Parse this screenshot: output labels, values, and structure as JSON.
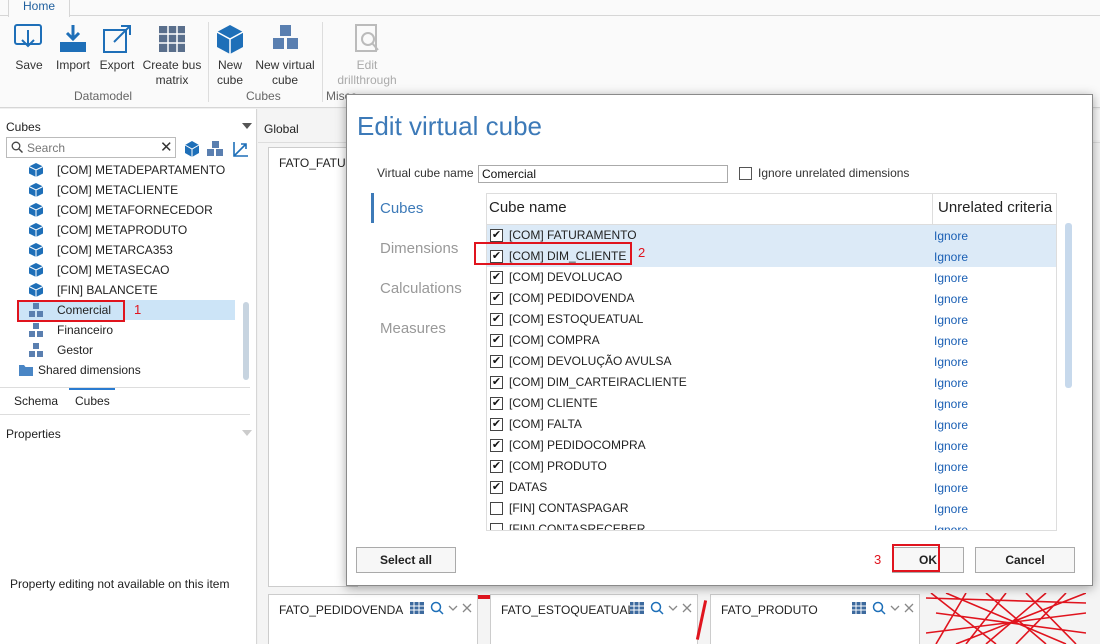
{
  "ribbon": {
    "tab": "Home",
    "buttons": {
      "save": "Save",
      "import": "Import",
      "export": "Export",
      "create_bus_1": "Create bus",
      "create_bus_2": "matrix",
      "new_cube_1": "New",
      "new_cube_2": "cube",
      "new_vcube_1": "New virtual",
      "new_vcube_2": "cube",
      "edit_dt_1": "Edit",
      "edit_dt_2": "drillthrough"
    },
    "groups": {
      "datamodel": "Datamodel",
      "cubes": "Cubes",
      "misc": "Misce"
    }
  },
  "left_panel": {
    "header": "Cubes",
    "search_placeholder": "Search",
    "search_clear": "✕",
    "tree": [
      {
        "label": "[COM] METADEPARTAMENTO",
        "icon": "cube-icon"
      },
      {
        "label": "[COM] METACLIENTE",
        "icon": "cube-icon"
      },
      {
        "label": "[COM] METAFORNECEDOR",
        "icon": "cube-icon"
      },
      {
        "label": "[COM] METAPRODUTO",
        "icon": "cube-icon"
      },
      {
        "label": "[COM] METARCA353",
        "icon": "cube-icon"
      },
      {
        "label": "[COM] METASECAO",
        "icon": "cube-icon"
      },
      {
        "label": "[FIN] BALANCETE",
        "icon": "cube-icon"
      },
      {
        "label": "Comercial",
        "icon": "virtual-cube-icon"
      },
      {
        "label": "Financeiro",
        "icon": "virtual-cube-icon"
      },
      {
        "label": "Gestor",
        "icon": "virtual-cube-icon"
      },
      {
        "label": "Shared dimensions",
        "icon": "folder-icon"
      }
    ],
    "tabs": {
      "schema": "Schema",
      "cubes": "Cubes"
    },
    "properties_header": "Properties",
    "properties_message": "Property editing not available on this item"
  },
  "annotations": {
    "n1": "1",
    "n2": "2",
    "n3": "3"
  },
  "canvas": {
    "global_tab": "Global",
    "cards": {
      "fato_fatur": "FATO_FATUR",
      "fato_pedidovenda": "FATO_PEDIDOVENDA",
      "fato_estoqueatual": "FATO_ESTOQUEATUAL",
      "fato_produto": "FATO_PRODUTO"
    }
  },
  "dialog": {
    "title": "Edit virtual cube",
    "name_label": "Virtual cube name",
    "name_value": "Comercial",
    "ignore_label": "Ignore unrelated dimensions",
    "side_tabs": {
      "cubes": "Cubes",
      "dimensions": "Dimensions",
      "calculations": "Calculations",
      "measures": "Measures"
    },
    "grid": {
      "col_name": "Cube name",
      "col_criteria": "Unrelated criteria",
      "rows": [
        {
          "name": "[COM] FATURAMENTO",
          "checked": "✔",
          "action": "Ignore"
        },
        {
          "name": "[COM] DIM_CLIENTE",
          "checked": "✔",
          "action": "Ignore"
        },
        {
          "name": "[COM] DEVOLUCAO",
          "checked": "✔",
          "action": "Ignore"
        },
        {
          "name": "[COM] PEDIDOVENDA",
          "checked": "✔",
          "action": "Ignore"
        },
        {
          "name": "[COM] ESTOQUEATUAL",
          "checked": "✔",
          "action": "Ignore"
        },
        {
          "name": "[COM] COMPRA",
          "checked": "✔",
          "action": "Ignore"
        },
        {
          "name": "[COM] DEVOLUÇÃO AVULSA",
          "checked": "✔",
          "action": "Ignore"
        },
        {
          "name": "[COM] DIM_CARTEIRACLIENTE",
          "checked": "✔",
          "action": "Ignore"
        },
        {
          "name": "[COM] CLIENTE",
          "checked": "✔",
          "action": "Ignore"
        },
        {
          "name": "[COM] FALTA",
          "checked": "✔",
          "action": "Ignore"
        },
        {
          "name": "[COM] PEDIDOCOMPRA",
          "checked": "✔",
          "action": "Ignore"
        },
        {
          "name": "[COM] PRODUTO",
          "checked": "✔",
          "action": "Ignore"
        },
        {
          "name": "DATAS",
          "checked": "✔",
          "action": "Ignore"
        },
        {
          "name": "[FIN] CONTASPAGAR",
          "checked": "",
          "action": "Ignore"
        },
        {
          "name": "[FIN] CONTASRECEBER",
          "checked": "",
          "action": "Ignore"
        }
      ]
    },
    "buttons": {
      "select_all": "Select all",
      "ok": "OK",
      "cancel": "Cancel"
    }
  },
  "colors": {
    "accent": "#3d7ab8",
    "annotation": "#e0141e",
    "link": "#1a5fb4",
    "selection": "#cce4f7"
  }
}
